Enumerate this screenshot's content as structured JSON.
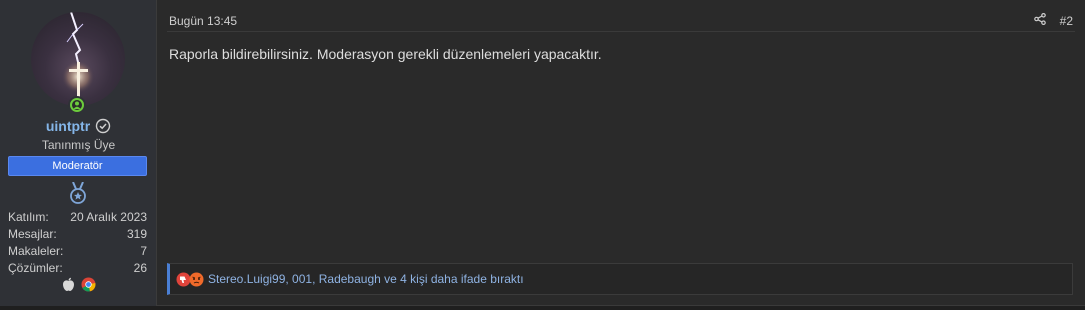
{
  "user": {
    "username": "uintptr",
    "title": "Tanınmış Üye",
    "role": "Moderatör",
    "stats": [
      {
        "label": "Katılım:",
        "value": "20 Aralık 2023"
      },
      {
        "label": "Mesajlar:",
        "value": "319"
      },
      {
        "label": "Makaleler:",
        "value": "7"
      },
      {
        "label": "Çözümler:",
        "value": "26"
      }
    ],
    "icons": {
      "avatar": "avatar-lightning-cross",
      "online": "online-status-icon",
      "verified": "verified-icon",
      "medal": "medal-icon",
      "os": "apple-icon",
      "browser": "chrome-icon"
    }
  },
  "post": {
    "timestamp": "Bugün 13:45",
    "number": "#2",
    "message": "Raporla bildirebilirsiniz. Moderasyon gerekli düzenlemeleri yapacaktır.",
    "reactions_text": "Stereo.Luigi99, 001, Radebaugh ve 4 kişi daha ifade bıraktı"
  },
  "colors": {
    "username": "#84b5e8",
    "role_banner": "#3b6fe0",
    "online": "#6ccb3c",
    "reaction_link": "#8fb3e3"
  }
}
